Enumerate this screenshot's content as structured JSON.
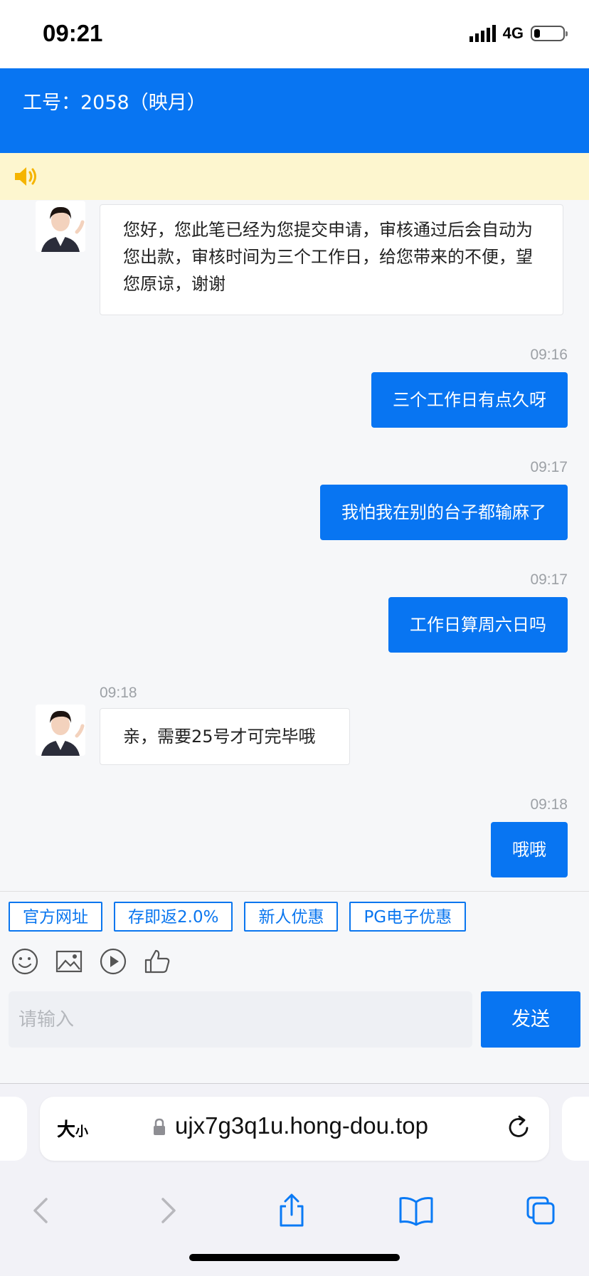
{
  "status_bar": {
    "time": "09:21",
    "network": "4G",
    "battery_level": 0.2
  },
  "header": {
    "title": "工号：2058（映月）"
  },
  "notice": {
    "icon": "speaker-icon"
  },
  "messages": [
    {
      "side": "in",
      "time": "",
      "text": "您好，您此笔已经为您提交申请，审核通过后会自动为您出款，审核时间为三个工作日，给您带来的不便，望您原谅，谢谢"
    },
    {
      "side": "out",
      "time": "09:16",
      "text": "三个工作日有点久呀"
    },
    {
      "side": "out",
      "time": "09:17",
      "text": "我怕我在别的台子都输麻了"
    },
    {
      "side": "out",
      "time": "09:17",
      "text": "工作日算周六日吗"
    },
    {
      "side": "in",
      "time": "09:18",
      "text": "亲，需要25号才可完毕哦"
    },
    {
      "side": "out",
      "time": "09:18",
      "text": "哦哦"
    }
  ],
  "quick_replies": [
    "官方网址",
    "存即返2.0%",
    "新人优惠",
    "PG电子优惠"
  ],
  "toolbar": {
    "icons": [
      "emoji-icon",
      "image-icon",
      "video-icon",
      "thumbs-up-icon"
    ]
  },
  "composer": {
    "placeholder": "请输入",
    "send_label": "发送"
  },
  "browser": {
    "text_size_label": "大",
    "text_size_small": "小",
    "url": "ujx7g3q1u.hong-dou.top"
  },
  "colors": {
    "primary": "#0875f2",
    "notice_bg": "#fdf6cf",
    "speaker": "#f5b400"
  }
}
